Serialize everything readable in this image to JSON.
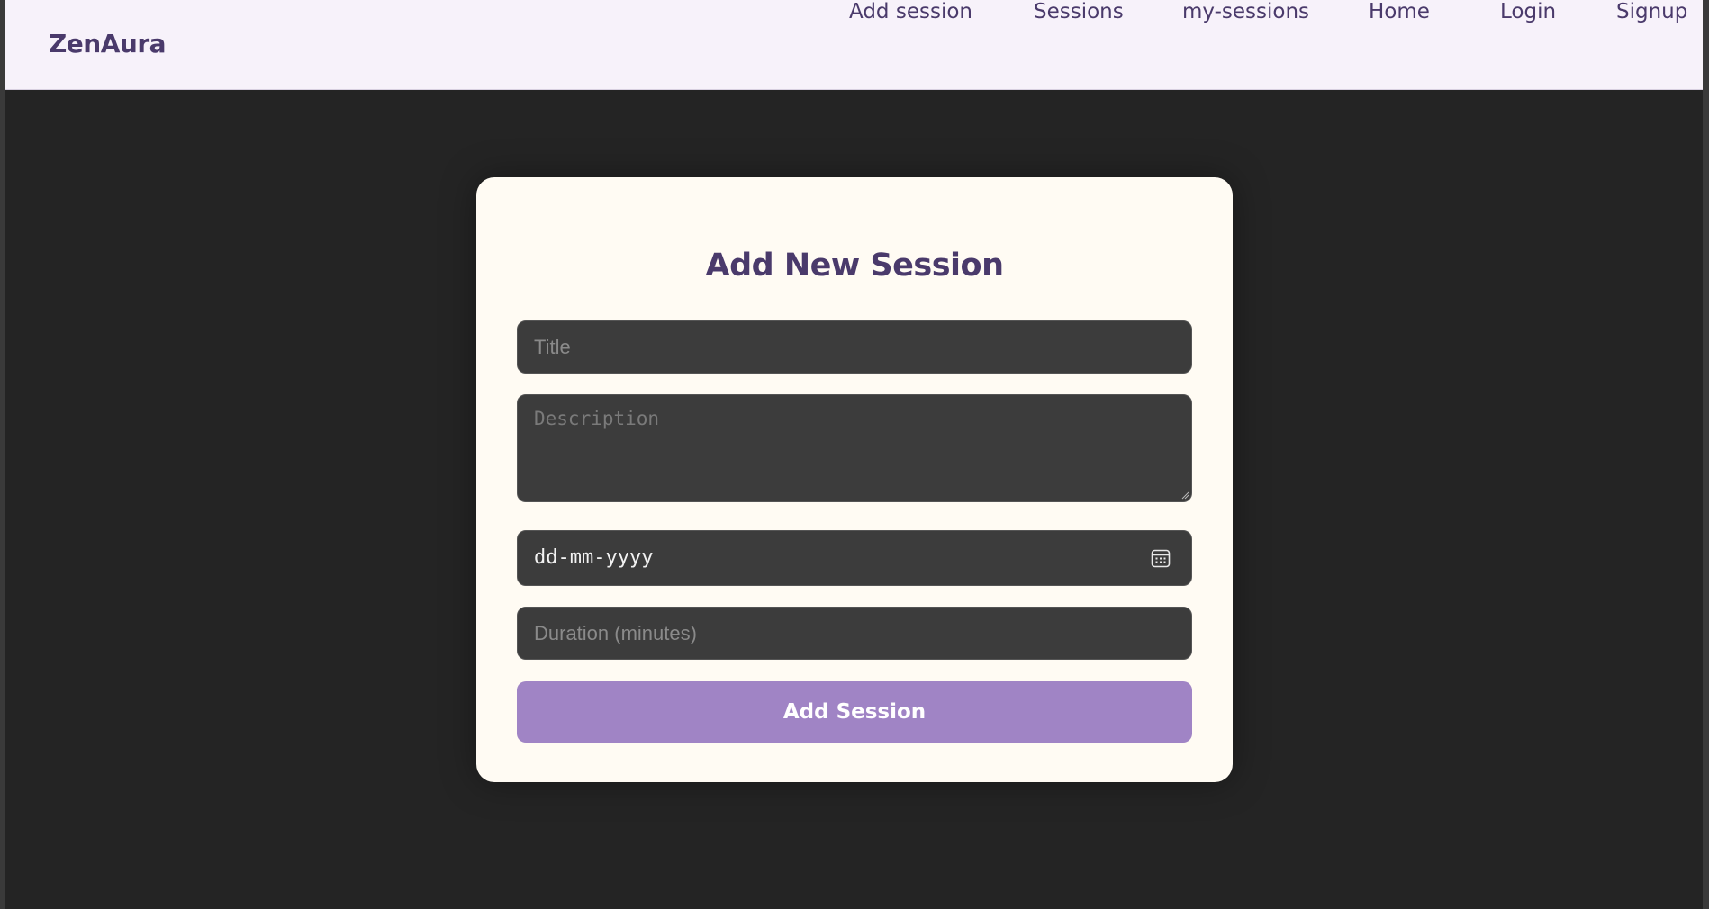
{
  "navbar": {
    "brand": "ZenAura",
    "links": [
      {
        "label": "Add session"
      },
      {
        "label": "Sessions"
      },
      {
        "label": "my-sessions"
      },
      {
        "label": "Home"
      },
      {
        "label": "Login"
      },
      {
        "label": "Signup"
      }
    ]
  },
  "form": {
    "heading": "Add New Session",
    "title_placeholder": "Title",
    "description_placeholder": "Description",
    "date_placeholder": "dd-mm-yyyy",
    "duration_placeholder": "Duration (minutes)",
    "submit_label": "Add Session",
    "calendar_icon": "calendar-icon"
  },
  "colors": {
    "accent": "#a084c5",
    "brand_text": "#4a3a6b",
    "navbar_bg": "#f7f2fa",
    "card_bg": "#fffbf3",
    "page_bg": "#242424",
    "input_bg": "#3c3c3c"
  }
}
